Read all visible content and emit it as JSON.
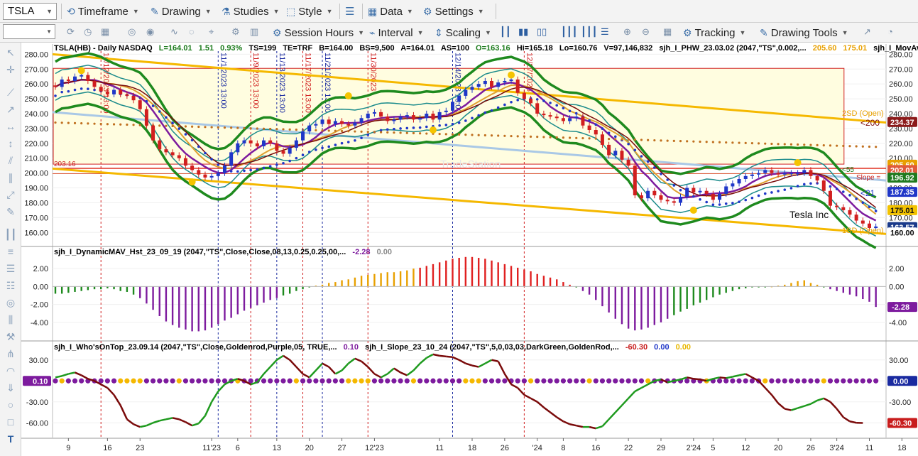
{
  "toolbar": {
    "symbol": "TSLA",
    "menus": [
      {
        "icon": "timeframe-icon",
        "label": "Timeframe"
      },
      {
        "icon": "drawing-icon",
        "label": "Drawing"
      },
      {
        "icon": "studies-icon",
        "label": "Studies"
      },
      {
        "icon": "style-icon",
        "label": "Style"
      },
      {
        "icon": "data-icon",
        "label": "Data"
      },
      {
        "icon": "gear-icon",
        "label": "Settings"
      }
    ],
    "row2": [
      {
        "icon": "session-hours-icon",
        "label": "Session Hours"
      },
      {
        "icon": "interval-icon",
        "label": "Interval"
      },
      {
        "icon": "scaling-icon",
        "label": "Scaling"
      },
      {
        "icon": "tracking-icon",
        "label": "Tracking"
      },
      {
        "icon": "drawing-tools-icon",
        "label": "Drawing Tools"
      }
    ]
  },
  "chart_data": [
    {
      "type": "candlestick",
      "pane": "price",
      "header": {
        "symbol": "TSLA(HB) - Daily NASDAQ",
        "L": "L=164.01",
        "chg": "1.51",
        "pct": "0.93%",
        "ts": "TS=199",
        "te": "TE=TRF",
        "b": "B=164.00",
        "bs": "BS=9,500",
        "a": "A=164.01",
        "as": "AS=100",
        "o": "O=163.16",
        "hi": "Hi=165.18",
        "lo": "Lo=160.76",
        "v": "V=97,146,832",
        "study": "sjh_I_PHW_23.03.02 (2047,\"TS\",0.002,...",
        "study_v1": "205.60",
        "study_v2": "175.01",
        "study2": "sjh_I_MovAvg_..."
      },
      "ylim": [
        152,
        284
      ],
      "yticks": [
        160,
        170,
        180,
        190,
        200,
        210,
        220,
        230,
        240,
        250,
        260,
        270,
        280
      ],
      "ytick_labels": [
        "160.00",
        "170.00",
        "180.00",
        "190.00",
        "200.00",
        "210.00",
        "220.00",
        "230.00",
        "240.00",
        "250.00",
        "260.00",
        "270.00",
        "280.00"
      ],
      "closes": [
        258,
        263,
        262,
        265,
        266,
        262,
        258,
        255,
        253,
        256,
        253,
        252,
        249,
        243,
        232,
        222,
        216,
        214,
        212,
        210,
        205,
        202,
        199,
        197,
        198,
        200,
        205,
        214,
        220,
        222,
        220,
        218,
        222,
        220,
        215,
        213,
        217,
        222,
        228,
        232,
        233,
        236,
        233,
        235,
        233,
        232,
        234,
        237,
        240,
        241,
        238,
        235,
        236,
        238,
        239,
        236,
        237,
        240,
        236,
        241,
        242,
        248,
        252,
        256,
        258,
        260,
        262,
        258,
        261,
        262,
        263,
        254,
        250,
        247,
        240,
        239,
        238,
        237,
        235,
        237,
        238,
        232,
        229,
        226,
        219,
        212,
        215,
        209,
        205,
        185,
        183,
        188,
        185,
        182,
        181,
        180,
        184,
        190,
        187,
        188,
        186,
        182,
        186,
        191,
        193,
        196,
        198,
        199,
        200,
        202,
        200,
        199,
        200,
        200,
        200,
        202,
        198,
        195,
        188,
        178,
        177,
        175,
        172,
        168,
        166,
        163,
        164
      ],
      "axis_tag_values": [
        {
          "label": "234.37",
          "color": "#8b1a1a"
        },
        {
          "label": "205.60",
          "color": "#e8a000"
        },
        {
          "label": "202.01",
          "color": "#e05a3a"
        },
        {
          "label": "196.92",
          "color": "#1e7a1e"
        },
        {
          "label": "187.35",
          "color": "#2037c8"
        },
        {
          "label": "175.01",
          "color": "#f2c200"
        },
        {
          "label": "163.57",
          "color": "#1a3a8a"
        },
        {
          "label": "160.00",
          "color": "#ffffff"
        }
      ],
      "annotations": {
        "sd2_open": "2SD (Open)",
        "sd_open": "1SD (Open)",
        "ma200": "<200",
        "ma21": "<21",
        "ma55": "<55",
        "slope": "Slope =",
        "company": "Tesla Inc",
        "watermark": "TradeStation",
        "level_left": "203.16"
      },
      "vline_dates": [
        "10/12/2023 13:00",
        "11/1/2023 13:00",
        "11/9/2023 13:00",
        "11/13/2023 13:00",
        "11/17/2023 13:00",
        "11/21/2023 13:00",
        "11/30/2023",
        "12/14/2023 13:00",
        "12/27/2023"
      ]
    },
    {
      "type": "bar",
      "pane": "histogram",
      "header": {
        "label": "sjh_I_DynamicMAV_Hst_23_09_19 (2047,\"TS\",Close,Close,08,13,0.25,0.25,00,...",
        "v1": "-2.28",
        "v2": "0.00"
      },
      "ylim": [
        -5.6,
        3.6
      ],
      "yticks": [
        2,
        0,
        -2,
        -4
      ],
      "ytick_labels": [
        "2.00",
        "0.00",
        "-2.00",
        "-4.00"
      ],
      "values": [
        -0.8,
        -0.8,
        -0.7,
        -0.6,
        -0.5,
        -0.4,
        -0.3,
        -0.3,
        -0.2,
        -0.3,
        -0.5,
        -0.6,
        -0.9,
        -1.3,
        -1.9,
        -2.6,
        -3.3,
        -3.9,
        -4.3,
        -4.6,
        -4.8,
        -5.0,
        -5.0,
        -4.9,
        -4.6,
        -4.2,
        -3.8,
        -3.5,
        -3.1,
        -2.7,
        -2.4,
        -2.1,
        -1.8,
        -1.5,
        -1.3,
        -1.0,
        -0.8,
        -0.5,
        -0.3,
        -0.1,
        0.1,
        0.2,
        0.4,
        0.5,
        0.7,
        0.8,
        1.0,
        1.2,
        1.3,
        1.4,
        1.5,
        1.6,
        1.6,
        1.7,
        1.8,
        2.0,
        2.1,
        2.3,
        2.5,
        2.7,
        2.9,
        3.1,
        3.2,
        3.3,
        3.3,
        3.2,
        3.1,
        2.9,
        2.7,
        2.5,
        2.3,
        2.1,
        1.9,
        1.7,
        1.4,
        1.2,
        1.0,
        0.8,
        0.5,
        0.2,
        -0.1,
        -0.5,
        -0.9,
        -1.5,
        -2.2,
        -2.9,
        -3.6,
        -4.2,
        -4.7,
        -4.9,
        -4.8,
        -4.6,
        -4.3,
        -4.0,
        -3.6,
        -3.2,
        -2.8,
        -2.5,
        -2.1,
        -1.8,
        -1.5,
        -1.2,
        -0.9,
        -0.7,
        -0.5,
        -0.3,
        -0.2,
        -0.1,
        -0.1,
        -0.1,
        0.0,
        0.1,
        0.2,
        0.4,
        0.6,
        0.7,
        0.4,
        0.2,
        -0.1,
        -0.3,
        -0.5,
        -0.7,
        -0.9,
        -1.1,
        -1.4,
        -1.7,
        -2.28
      ],
      "tag": "-2.28"
    },
    {
      "type": "line",
      "pane": "oscillator",
      "header": {
        "label": "sjh_I_Who'sOnTop_23.09.14 (2047,\"TS\",Close,Goldenrod,Purple,05,  TRUE,...",
        "v1": "0.10",
        "label2": "sjh_I_Slope_23_10_24 (2047,\"TS\",5,0,03,03,DarkGreen,GoldenRod,...",
        "v2": "-60.30",
        "v3": "0.00",
        "v4": "0.00"
      },
      "ylim": [
        -75,
        45
      ],
      "yticks": [
        30,
        0,
        -30,
        -60
      ],
      "ytick_labels": [
        "30.00",
        "0.00",
        "-30.00",
        "-60.00"
      ],
      "values": [
        5,
        7,
        10,
        12,
        8,
        3,
        0,
        -5,
        -10,
        -20,
        -35,
        -55,
        -62,
        -66,
        -64,
        -60,
        -57,
        -55,
        -53,
        -55,
        -59,
        -64,
        -61,
        -50,
        -30,
        -15,
        -5,
        0,
        3,
        0,
        -5,
        -2,
        10,
        20,
        30,
        36,
        30,
        20,
        10,
        5,
        15,
        25,
        20,
        10,
        15,
        25,
        32,
        28,
        20,
        10,
        5,
        10,
        18,
        12,
        8,
        15,
        25,
        33,
        38,
        36,
        35,
        34,
        30,
        25,
        22,
        20,
        25,
        30,
        28,
        10,
        -5,
        -10,
        -20,
        -25,
        -30,
        -38,
        -45,
        -52,
        -58,
        -62,
        -64,
        -66,
        -66,
        -68,
        -65,
        -55,
        -45,
        -35,
        -25,
        -15,
        -10,
        -5,
        0,
        2,
        -2,
        0,
        2,
        5,
        3,
        2,
        0,
        3,
        5,
        4,
        6,
        8,
        10,
        5,
        0,
        -10,
        -20,
        -32,
        -40,
        -42,
        -39,
        -36,
        -33,
        -28,
        -25,
        -30,
        -40,
        -52,
        -58,
        -60,
        -60.3
      ],
      "tag_left": "0.10",
      "tag_right_top": "0.00",
      "tag_right_bottom": "-60.30"
    }
  ],
  "x_axis": {
    "labels": [
      {
        "t": "9",
        "i": 2
      },
      {
        "t": "16",
        "i": 8
      },
      {
        "t": "23",
        "i": 13
      },
      {
        "t": "11'23",
        "i": 24
      },
      {
        "t": "6",
        "i": 28
      },
      {
        "t": "13",
        "i": 34
      },
      {
        "t": "20",
        "i": 39
      },
      {
        "t": "27",
        "i": 44
      },
      {
        "t": "12'23",
        "i": 49
      },
      {
        "t": "11",
        "i": 59
      },
      {
        "t": "18",
        "i": 64
      },
      {
        "t": "26",
        "i": 69
      },
      {
        "t": "'24",
        "i": 74
      },
      {
        "t": "8",
        "i": 78
      },
      {
        "t": "16",
        "i": 83
      },
      {
        "t": "22",
        "i": 88
      },
      {
        "t": "29",
        "i": 93
      },
      {
        "t": "2'24",
        "i": 98
      },
      {
        "t": "5",
        "i": 101
      },
      {
        "t": "12",
        "i": 106
      },
      {
        "t": "20",
        "i": 111
      },
      {
        "t": "26",
        "i": 116
      },
      {
        "t": "3'24",
        "i": 120
      },
      {
        "t": "11",
        "i": 125
      },
      {
        "t": "18",
        "i": 130
      }
    ]
  },
  "colors": {
    "up": "#2037c8",
    "down": "#d11f1f",
    "green": "#1e8a1e",
    "purple": "#7d1b9e",
    "gold": "#f2b200",
    "teal": "#1b8b8b",
    "dark_red": "#7a0a0a"
  }
}
